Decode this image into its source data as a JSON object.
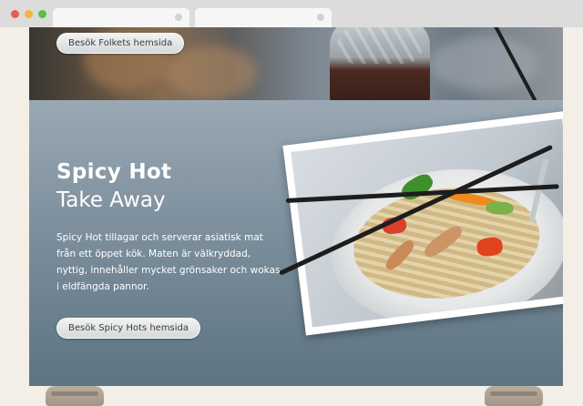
{
  "browser": {
    "window_controls": [
      "close-control",
      "minimize-control",
      "maximize-control"
    ],
    "tabs": [
      {
        "label": ""
      },
      {
        "label": ""
      }
    ]
  },
  "banner": {
    "button_label": "Besök Folkets hemsida"
  },
  "hero": {
    "title": "Spicy Hot",
    "subtitle": "Take Away",
    "description": "Spicy Hot tillagar och serverar asiatisk mat från ett öppet kök. Maten är välkryddad, nyttig, innehåller mycket grönsaker och wokas i eldfängda pannor.",
    "button_label": "Besök Spicy Hots hemsida"
  },
  "colors": {
    "hero_top": "#9aa8b3",
    "hero_bottom": "#5d7483",
    "text": "#ffffff"
  }
}
